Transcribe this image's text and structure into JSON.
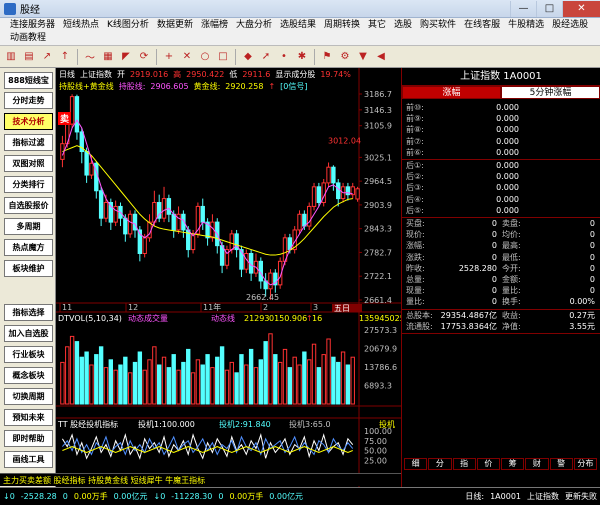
{
  "window": {
    "title": "股经",
    "minimize": "—",
    "maximize": "□",
    "close": "✕"
  },
  "menu": [
    "连接服务器",
    "短线热点",
    "K线图分析",
    "数据更新",
    "涨幅榜",
    "大盘分析",
    "选股结果",
    "周期转换",
    "其它",
    "选股",
    "购买软件",
    "在线客服",
    "牛股精选",
    "股经选股",
    "动画教程"
  ],
  "toolbar_icons": [
    "candle-chart-icon",
    "bar-chart-icon",
    "line-up-icon",
    "arrow-up-icon",
    "trend-icon",
    "grid-icon",
    "fan-icon",
    "refresh-icon",
    "plus-icon",
    "cross-icon",
    "circle-icon",
    "square-icon",
    "palette-icon",
    "arrow-icon",
    "dot-icon",
    "spin-icon",
    "flag-icon",
    "gear-icon",
    "down-icon",
    "arrow-left-icon"
  ],
  "sidebar": [
    {
      "label": "888短线宝",
      "active": false
    },
    {
      "label": "分时走势",
      "active": false
    },
    {
      "label": "技术分析",
      "active": true
    },
    {
      "label": "指标过滤",
      "active": false
    },
    {
      "label": "双图对照",
      "active": false
    },
    {
      "label": "分类排行",
      "active": false
    },
    {
      "label": "自选股报价",
      "active": false
    },
    {
      "label": "多周期",
      "active": false
    },
    {
      "label": "热点魔方",
      "active": false
    },
    {
      "label": "板块维护",
      "active": false
    },
    {
      "label": "指标选择",
      "active": false
    },
    {
      "label": "加入自选股",
      "active": false
    },
    {
      "label": "行业板块",
      "active": false
    },
    {
      "label": "概念板块",
      "active": false
    },
    {
      "label": "切换周期",
      "active": false
    },
    {
      "label": "预知未来",
      "active": false
    },
    {
      "label": "即时帮助",
      "active": false
    },
    {
      "label": "画线工具",
      "active": false
    }
  ],
  "chart_header": {
    "period": "日线",
    "name": "上证指数",
    "open_label": "开",
    "open": "2919.016",
    "high_label": "高",
    "high": "2950.422",
    "low_label": "低",
    "low": "2911.6",
    "hint": "显示成分股",
    "pct": "19.74%",
    "indicator_line": "持股线+黄金线",
    "hold_label": "持股线:",
    "hold": "2906.605",
    "gold_label": "黄金线:",
    "gold": "2920.258",
    "signal": "[0信号]"
  },
  "price_axis": [
    "3186.7",
    "3146.3",
    "3105.9",
    "3025.1",
    "2964.5",
    "2903.9",
    "2843.3",
    "2782.7",
    "2722.1",
    "2661.4"
  ],
  "peak_label": "3012.04",
  "low_label_chart": "2662.45",
  "sell_marker": "卖",
  "date_axis": [
    "11",
    "12",
    "11年",
    "2",
    "3"
  ],
  "period_badge": "五日",
  "volume_header": {
    "name": "DTVOL(5,10,34)",
    "title": "动态成交量",
    "line": "动态线",
    "v1": "21293",
    "v2": "0150.906",
    "v3": "↑",
    "v4": "16",
    "value": "135945025"
  },
  "volume_axis": [
    "27573.3",
    "20679.9",
    "13786.6",
    "6893.3"
  ],
  "osc_header": {
    "name": "TT 股经投机指标",
    "l1": "投机1:100.000",
    "l2": "投机2:91.840",
    "l3": "投机3:65.0",
    "tag": "投机"
  },
  "osc_axis": [
    "100.00",
    "75.00",
    "50.00",
    "25.00"
  ],
  "info": {
    "title": "上证指数 1A0001",
    "tabs": [
      "涨幅",
      "5分钟涨幅"
    ],
    "before": [
      {
        "label": "前⑩:",
        "value": "0.000"
      },
      {
        "label": "前⑨:",
        "value": "0.000"
      },
      {
        "label": "前⑧:",
        "value": "0.000"
      },
      {
        "label": "前⑦:",
        "value": "0.000"
      },
      {
        "label": "前⑥:",
        "value": "0.000"
      }
    ],
    "after": [
      {
        "label": "后①:",
        "value": "0.000"
      },
      {
        "label": "后②:",
        "value": "0.000"
      },
      {
        "label": "后③:",
        "value": "0.000"
      },
      {
        "label": "后④:",
        "value": "0.000"
      },
      {
        "label": "后⑤:",
        "value": "0.000"
      }
    ],
    "stats": [
      {
        "l1": "买盘:",
        "v1": "0",
        "l2": "卖盘:",
        "v2": "0"
      },
      {
        "l1": "现价:",
        "v1": "0",
        "l2": "均价:",
        "v2": "0"
      },
      {
        "l1": "涨幅:",
        "v1": "0",
        "l2": "最高:",
        "v2": "0"
      },
      {
        "l1": "涨跌:",
        "v1": "0",
        "l2": "最低:",
        "v2": "0"
      },
      {
        "l1": "昨收:",
        "v1": "2528.280",
        "l2": "今开:",
        "v2": "0"
      },
      {
        "l1": "总量:",
        "v1": "0",
        "l2": "金额:",
        "v2": "0"
      },
      {
        "l1": "现量:",
        "v1": "0",
        "l2": "量比:",
        "v2": "0"
      },
      {
        "l1": "量比:",
        "v1": "0",
        "l2": "换手:",
        "v2": "0.00%"
      }
    ],
    "totals": [
      {
        "l1": "总股本:",
        "v1": "29354.4867亿",
        "l2": "收益:",
        "v2": "0.27元"
      },
      {
        "l1": "流通股:",
        "v1": "17753.8364亿",
        "l2": "净值:",
        "v2": "3.55元"
      }
    ]
  },
  "bottom_tabs": [
    "细",
    "分",
    "指",
    "价",
    "筹",
    "财",
    "警",
    "分布"
  ],
  "marquee": "主力买卖差额 股经指标 持股黄金线  短线犀牛  牛魔王指标",
  "status": {
    "i1": "↓0",
    "i2": "-2528.28",
    "i3": "0",
    "i4": "0.00万手",
    "i5": "0.00亿元",
    "i6": "↓0",
    "i7": "-11228.30",
    "i8": "0",
    "i9": "0.00万手",
    "i10": "0.00亿元",
    "mode": "日线:",
    "code": "1A0001",
    "name": "上证指数",
    "msg": "更新失败"
  },
  "colors": {
    "up": "#ff3232",
    "down": "#54ffff",
    "grid": "#800000",
    "yellow": "#ffff00",
    "purple": "#ff55ff"
  },
  "chart_data": {
    "type": "line",
    "candles": [
      {
        "o": 3020,
        "c": 3060,
        "h": 3080,
        "l": 3000
      },
      {
        "o": 3060,
        "c": 3110,
        "h": 3130,
        "l": 3050
      },
      {
        "o": 3110,
        "c": 3180,
        "h": 3186,
        "l": 3100
      },
      {
        "o": 3180,
        "c": 3090,
        "h": 3185,
        "l": 3070
      },
      {
        "o": 3090,
        "c": 3040,
        "h": 3100,
        "l": 3010
      },
      {
        "o": 3040,
        "c": 2980,
        "h": 3050,
        "l": 2960
      },
      {
        "o": 2980,
        "c": 3010,
        "h": 3030,
        "l": 2970
      },
      {
        "o": 3010,
        "c": 2940,
        "h": 3015,
        "l": 2920
      },
      {
        "o": 2940,
        "c": 2870,
        "h": 2950,
        "l": 2850
      },
      {
        "o": 2870,
        "c": 2910,
        "h": 2930,
        "l": 2860
      },
      {
        "o": 2910,
        "c": 2860,
        "h": 2920,
        "l": 2840
      },
      {
        "o": 2860,
        "c": 2900,
        "h": 2915,
        "l": 2850
      },
      {
        "o": 2900,
        "c": 2870,
        "h": 2910,
        "l": 2850
      },
      {
        "o": 2870,
        "c": 2830,
        "h": 2880,
        "l": 2810
      },
      {
        "o": 2830,
        "c": 2880,
        "h": 2890,
        "l": 2820
      },
      {
        "o": 2880,
        "c": 2840,
        "h": 2890,
        "l": 2820
      },
      {
        "o": 2840,
        "c": 2780,
        "h": 2850,
        "l": 2760
      },
      {
        "o": 2780,
        "c": 2820,
        "h": 2830,
        "l": 2770
      },
      {
        "o": 2820,
        "c": 2860,
        "h": 2880,
        "l": 2810
      },
      {
        "o": 2860,
        "c": 2910,
        "h": 2940,
        "l": 2850
      },
      {
        "o": 2910,
        "c": 2870,
        "h": 2930,
        "l": 2860
      },
      {
        "o": 2870,
        "c": 2920,
        "h": 2950,
        "l": 2860
      },
      {
        "o": 2920,
        "c": 2880,
        "h": 2930,
        "l": 2860
      },
      {
        "o": 2880,
        "c": 2840,
        "h": 2890,
        "l": 2820
      },
      {
        "o": 2840,
        "c": 2880,
        "h": 2900,
        "l": 2830
      },
      {
        "o": 2880,
        "c": 2840,
        "h": 2890,
        "l": 2820
      },
      {
        "o": 2840,
        "c": 2790,
        "h": 2850,
        "l": 2770
      },
      {
        "o": 2790,
        "c": 2830,
        "h": 2840,
        "l": 2780
      },
      {
        "o": 2830,
        "c": 2900,
        "h": 2910,
        "l": 2820
      },
      {
        "o": 2900,
        "c": 2860,
        "h": 2920,
        "l": 2840
      },
      {
        "o": 2860,
        "c": 2820,
        "h": 2870,
        "l": 2800
      },
      {
        "o": 2820,
        "c": 2860,
        "h": 2880,
        "l": 2810
      },
      {
        "o": 2860,
        "c": 2800,
        "h": 2870,
        "l": 2780
      },
      {
        "o": 2800,
        "c": 2750,
        "h": 2810,
        "l": 2730
      },
      {
        "o": 2750,
        "c": 2790,
        "h": 2800,
        "l": 2740
      },
      {
        "o": 2790,
        "c": 2830,
        "h": 2840,
        "l": 2780
      },
      {
        "o": 2830,
        "c": 2790,
        "h": 2840,
        "l": 2770
      },
      {
        "o": 2790,
        "c": 2740,
        "h": 2800,
        "l": 2720
      },
      {
        "o": 2740,
        "c": 2780,
        "h": 2790,
        "l": 2730
      },
      {
        "o": 2780,
        "c": 2730,
        "h": 2790,
        "l": 2710
      },
      {
        "o": 2730,
        "c": 2760,
        "h": 2780,
        "l": 2720
      },
      {
        "o": 2760,
        "c": 2710,
        "h": 2770,
        "l": 2690
      },
      {
        "o": 2710,
        "c": 2690,
        "h": 2730,
        "l": 2670
      },
      {
        "o": 2690,
        "c": 2730,
        "h": 2740,
        "l": 2662
      },
      {
        "o": 2730,
        "c": 2700,
        "h": 2740,
        "l": 2680
      },
      {
        "o": 2700,
        "c": 2760,
        "h": 2770,
        "l": 2690
      },
      {
        "o": 2760,
        "c": 2820,
        "h": 2830,
        "l": 2750
      },
      {
        "o": 2820,
        "c": 2790,
        "h": 2830,
        "l": 2780
      },
      {
        "o": 2790,
        "c": 2840,
        "h": 2850,
        "l": 2780
      },
      {
        "o": 2840,
        "c": 2880,
        "h": 2890,
        "l": 2830
      },
      {
        "o": 2880,
        "c": 2850,
        "h": 2890,
        "l": 2840
      },
      {
        "o": 2850,
        "c": 2900,
        "h": 2910,
        "l": 2840
      },
      {
        "o": 2900,
        "c": 2950,
        "h": 2960,
        "l": 2890
      },
      {
        "o": 2950,
        "c": 2910,
        "h": 2960,
        "l": 2900
      },
      {
        "o": 2910,
        "c": 2960,
        "h": 2970,
        "l": 2900
      },
      {
        "o": 2960,
        "c": 3000,
        "h": 3012,
        "l": 2950
      },
      {
        "o": 3000,
        "c": 2960,
        "h": 3005,
        "l": 2940
      },
      {
        "o": 2960,
        "c": 2920,
        "h": 2970,
        "l": 2900
      },
      {
        "o": 2920,
        "c": 2950,
        "h": 2960,
        "l": 2910
      },
      {
        "o": 2950,
        "c": 2930,
        "h": 2960,
        "l": 2915
      },
      {
        "o": 2930,
        "c": 2950,
        "h": 2960,
        "l": 2920
      },
      {
        "o": 2919,
        "c": 2945,
        "h": 2950,
        "l": 2912
      }
    ],
    "ma_yellow": [
      3040,
      3045,
      3050,
      3055,
      3050,
      3040,
      3030,
      3015,
      3000,
      2985,
      2970,
      2955,
      2940,
      2925,
      2910,
      2895,
      2880,
      2868,
      2858,
      2850,
      2845,
      2842,
      2840,
      2838,
      2836,
      2834,
      2832,
      2830,
      2828,
      2826,
      2824,
      2822,
      2818,
      2814,
      2810,
      2806,
      2802,
      2798,
      2794,
      2790,
      2786,
      2782,
      2778,
      2776,
      2776,
      2778,
      2782,
      2788,
      2796,
      2806,
      2818,
      2832,
      2846,
      2860,
      2874,
      2886,
      2898,
      2906,
      2912,
      2918,
      2920
    ],
    "ma_purple": [
      3030,
      3060,
      3100,
      3120,
      3100,
      3060,
      3020,
      2990,
      2950,
      2920,
      2900,
      2890,
      2885,
      2870,
      2860,
      2855,
      2830,
      2820,
      2830,
      2860,
      2880,
      2890,
      2895,
      2880,
      2870,
      2865,
      2840,
      2825,
      2840,
      2860,
      2855,
      2845,
      2830,
      2800,
      2780,
      2790,
      2800,
      2785,
      2765,
      2750,
      2745,
      2730,
      2710,
      2700,
      2705,
      2720,
      2760,
      2790,
      2810,
      2830,
      2850,
      2860,
      2880,
      2900,
      2925,
      2950,
      2955,
      2945,
      2935,
      2935,
      2932
    ],
    "ylim": [
      2661.4,
      3186.7
    ],
    "volume": [
      16,
      22,
      26,
      24,
      18,
      20,
      15,
      19,
      22,
      14,
      17,
      13,
      15,
      18,
      12,
      16,
      20,
      13,
      17,
      22,
      15,
      18,
      14,
      19,
      13,
      16,
      21,
      12,
      17,
      15,
      19,
      14,
      18,
      22,
      13,
      16,
      12,
      19,
      15,
      21,
      14,
      17,
      24,
      27,
      19,
      16,
      21,
      14,
      18,
      15,
      20,
      17,
      23,
      14,
      19,
      25,
      18,
      16,
      20,
      15,
      18
    ],
    "volume_ylim": [
      0,
      27573.3
    ],
    "osc1": [
      80,
      60,
      90,
      40,
      70,
      30,
      55,
      85,
      45,
      65,
      35,
      75,
      50,
      90,
      40,
      60,
      30,
      80,
      55,
      70,
      45,
      85,
      35,
      65,
      50,
      75,
      40,
      90,
      55,
      30,
      70,
      45,
      80,
      60,
      35,
      85,
      50,
      65,
      40,
      75,
      55,
      90,
      30,
      70,
      45,
      60,
      80,
      40,
      65,
      55,
      85,
      35,
      75,
      50,
      90,
      45,
      60,
      70,
      40,
      80,
      65
    ],
    "osc2": [
      60,
      75,
      50,
      80,
      45,
      65,
      40,
      70,
      55,
      85,
      45,
      60,
      70,
      40,
      75,
      50,
      65,
      45,
      80,
      55,
      70,
      40,
      60,
      85,
      50,
      65,
      75,
      45,
      60,
      80,
      50,
      70,
      40,
      65,
      55,
      75,
      45,
      85,
      60,
      50,
      70,
      40,
      80,
      55,
      65,
      75,
      45,
      60,
      85,
      50,
      70,
      55,
      40,
      75,
      65,
      45,
      80,
      60,
      50,
      70,
      55
    ],
    "osc3": [
      50,
      55,
      60,
      55,
      50,
      45,
      50,
      55,
      60,
      55,
      50,
      45,
      50,
      55,
      60,
      55,
      50,
      45,
      50,
      55,
      60,
      55,
      50,
      45,
      50,
      55,
      60,
      55,
      50,
      45,
      50,
      55,
      60,
      55,
      50,
      45,
      50,
      55,
      60,
      55,
      50,
      45,
      50,
      55,
      60,
      55,
      50,
      45,
      50,
      55,
      60,
      55,
      50,
      45,
      50,
      55,
      60,
      55,
      50,
      45,
      50
    ]
  }
}
